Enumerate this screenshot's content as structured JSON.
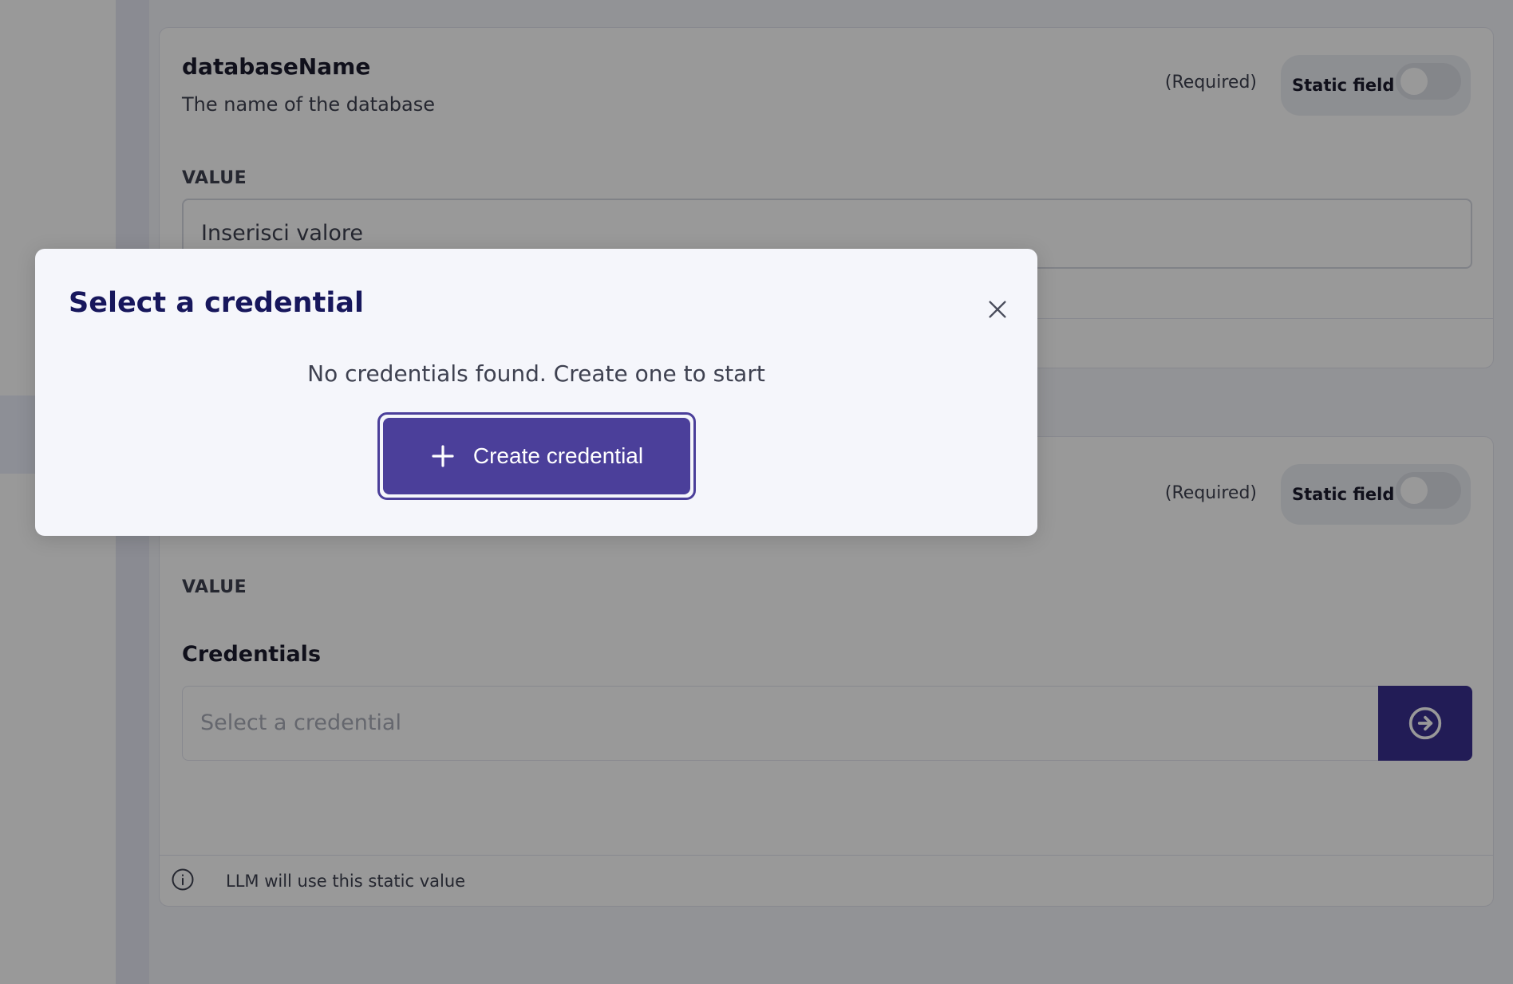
{
  "params": [
    {
      "name": "databaseName",
      "description": "The name of the database",
      "required_label": "(Required)",
      "static_field_label": "Static field",
      "static_field_on": false,
      "value_label": "VALUE",
      "value_placeholder": "Inserisci valore"
    },
    {
      "required_label": "(Required)",
      "static_field_label": "Static field",
      "static_field_on": false,
      "value_label": "VALUE",
      "credentials_label": "Credentials",
      "credentials_placeholder": "Select a credential",
      "info_text": "LLM will use this static value"
    }
  ],
  "modal": {
    "title": "Select a credential",
    "empty_message": "No credentials found. Create one to start",
    "create_button_label": "Create credential"
  },
  "icons": {
    "close": "close-icon",
    "plus": "plus-icon",
    "arrow": "arrow-right-circle-icon",
    "info": "info-icon"
  },
  "colors": {
    "accent": "#4b3f9a",
    "accent_dark": "#3a2f8f",
    "title": "#17175c"
  }
}
